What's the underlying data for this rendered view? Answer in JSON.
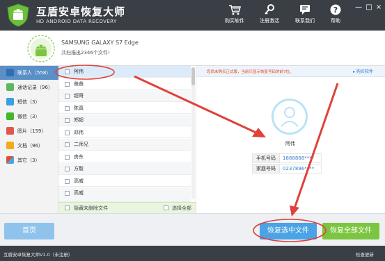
{
  "app": {
    "title": "互盾安卓恢复大师",
    "subtitle": "HD ANDROID DATA RECOVERY"
  },
  "toolbar": {
    "items": [
      {
        "label": "购买软件",
        "icon": "cart-icon"
      },
      {
        "label": "注册激活",
        "icon": "key-icon"
      },
      {
        "label": "联系我们",
        "icon": "chat-icon"
      },
      {
        "label": "帮助",
        "icon": "help-icon"
      }
    ],
    "window_controls": [
      "—",
      "□",
      "×"
    ]
  },
  "device": {
    "name": "SAMSUNG GALAXY S7 Edge",
    "count_text": "共扫描出2346个文件!"
  },
  "sidebar": {
    "items": [
      {
        "label": "联系人（558）",
        "icon": "contacts-icon",
        "color": "#3f7fc4",
        "active": true
      },
      {
        "label": "通话记录（96）",
        "icon": "phone-icon",
        "color": "#5cb85c"
      },
      {
        "label": "短信（3）",
        "icon": "sms-icon",
        "color": "#3aa0e0"
      },
      {
        "label": "微信（3）",
        "icon": "wechat-icon",
        "color": "#42b72a"
      },
      {
        "label": "图片（159）",
        "icon": "picture-icon",
        "color": "#e2574c"
      },
      {
        "label": "文档（96）",
        "icon": "document-icon",
        "color": "#f0ad1b"
      },
      {
        "label": "其它（3）",
        "icon": "other-icon",
        "color": "#e0502f"
      }
    ]
  },
  "contacts": {
    "rows": [
      "阿伟",
      "爸爸",
      "超哥",
      "陈真",
      "郑超",
      "邓伟",
      "二师兄",
      "房东",
      "方毅",
      "高威",
      "高威"
    ],
    "hide_deleted_label": "隐藏未删除文件",
    "select_all_label": "选择全部"
  },
  "detail": {
    "notice": "您尚未购买正式版，当前只显示恢复号码的前7位。",
    "buy_link": "购买软件",
    "contact_name": "阿伟",
    "fields": [
      {
        "label": "手机号码",
        "value": "1888888****"
      },
      {
        "label": "家庭号码",
        "value": "0237896****"
      }
    ]
  },
  "buttons": {
    "home": "首页",
    "recover_selected": "恢复选中文件",
    "recover_all": "恢复全部文件"
  },
  "status": {
    "left": "互盾安卓恢复大师V1.0（未注册）",
    "right": "检查更新"
  },
  "colors": {
    "titlebar": "#3a3f46",
    "accent": "#4aa3e4",
    "green": "#7cc540",
    "annotation": "#e0413a"
  }
}
